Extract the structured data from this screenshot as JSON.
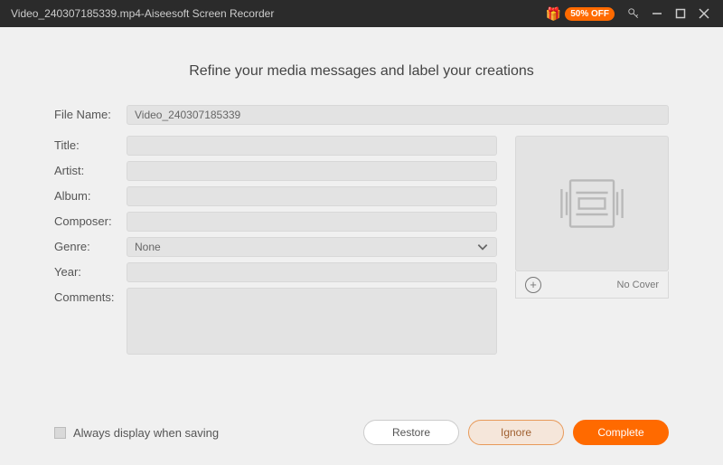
{
  "titlebar": {
    "filename": "Video_240307185339.mp4",
    "separator": "  -  ",
    "appname": "Aiseesoft Screen Recorder",
    "promo_text": "50% OFF"
  },
  "heading": "Refine your media messages and label your creations",
  "labels": {
    "filename": "File Name:",
    "title": "Title:",
    "artist": "Artist:",
    "album": "Album:",
    "composer": "Composer:",
    "genre": "Genre:",
    "year": "Year:",
    "comments": "Comments:"
  },
  "values": {
    "filename": "Video_240307185339",
    "title": "",
    "artist": "",
    "album": "",
    "composer": "",
    "genre": "None",
    "year": "",
    "comments": ""
  },
  "cover": {
    "no_cover": "No Cover"
  },
  "footer": {
    "always_display": "Always display when saving",
    "restore": "Restore",
    "ignore": "Ignore",
    "complete": "Complete"
  }
}
